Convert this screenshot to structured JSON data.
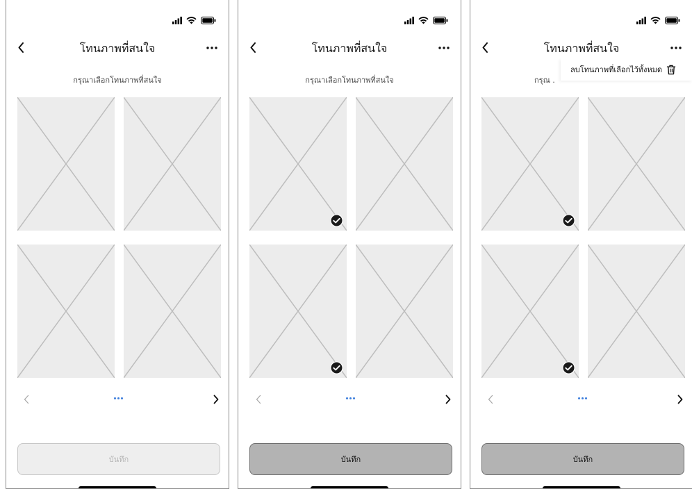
{
  "screens": [
    {
      "title": "โทนภาพที่สนใจ",
      "subtitle": "กรุณาเลือกโทนภาพที่สนใจ",
      "more_label": "...",
      "save_label": "บันทึก",
      "save_state": "disabled",
      "selected_tiles": []
    },
    {
      "title": "โทนภาพที่สนใจ",
      "subtitle": "กรุณาเลือกโทนภาพที่สนใจ",
      "more_label": "...",
      "save_label": "บันทึก",
      "save_state": "enabled",
      "selected_tiles": [
        1,
        3
      ]
    },
    {
      "title": "โทนภาพที่สนใจ",
      "subtitle_partial": "กรุณ .",
      "more_label": "...",
      "save_label": "บันทึก",
      "save_state": "enabled",
      "selected_tiles": [
        1,
        3
      ],
      "menu": {
        "clear_all_label": "ลบโทนภาพที่เลือกไว้ทั้งหมด",
        "icon": "trash-icon"
      }
    }
  ],
  "colors": {
    "placeholder_bg": "#ececec",
    "dot_accent": "#3d7fdc",
    "save_enabled_bg": "#b3b3b3",
    "save_disabled_bg": "#eeeeee"
  }
}
